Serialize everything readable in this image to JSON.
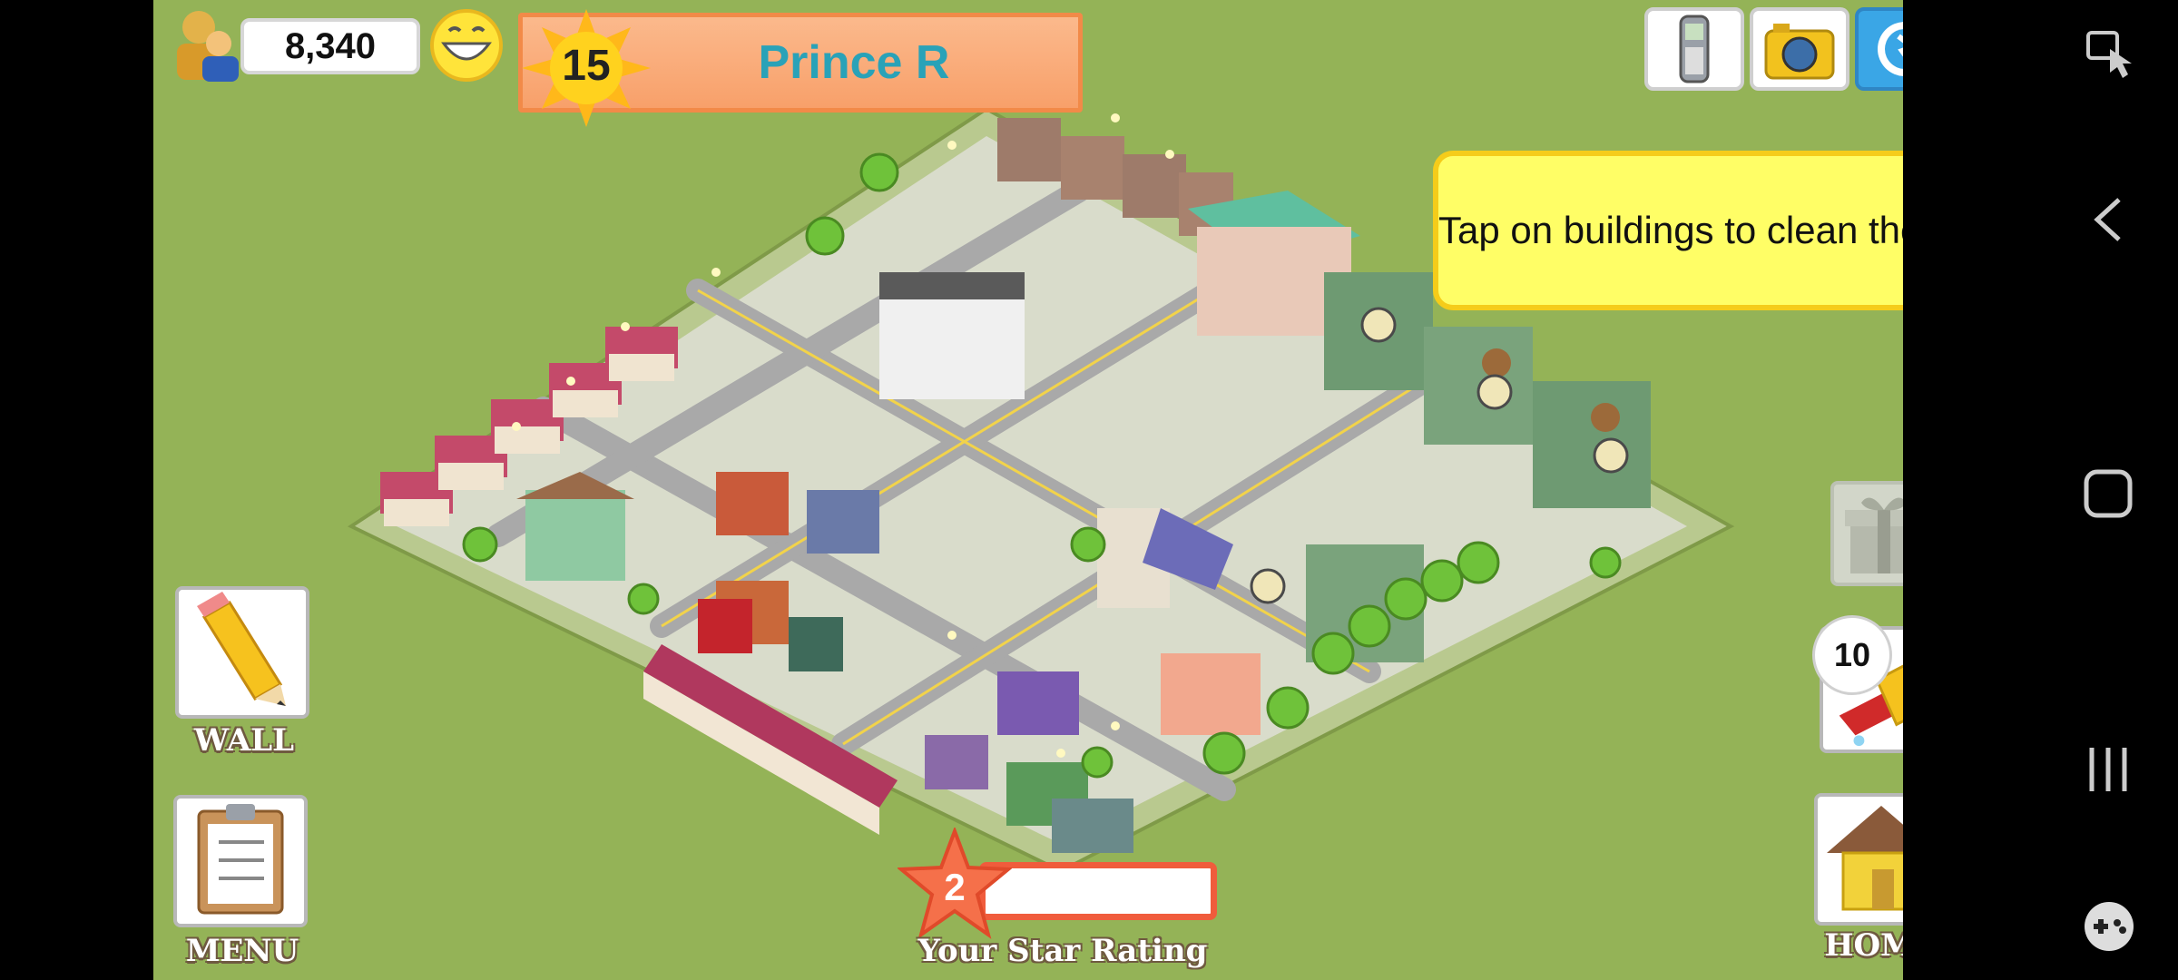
{
  "hud": {
    "population": "8,340",
    "level": "15",
    "player_name": "Prince R"
  },
  "tooltip": "Tap on buildings to clean them.",
  "buttons": {
    "wall": "WALL",
    "menu": "MENU",
    "home": "HOME",
    "clean_count": "10"
  },
  "star_rating": {
    "value": "2",
    "label": "Your Star Rating",
    "progress": 0.0
  },
  "icons": {
    "population": "people-icon",
    "happiness": "smiley-icon",
    "level": "sun-badge-icon",
    "phone": "cellphone-icon",
    "camera": "camera-icon",
    "social": "game-network-icon",
    "gift": "gift-icon",
    "clean": "sponge-icon",
    "wall": "pencil-icon",
    "menu": "clipboard-icon",
    "home": "house-icon"
  },
  "colors": {
    "grass": "#94b357",
    "banner": "#f8a06a",
    "player_name": "#29a2b8",
    "tooltip_bg": "#fffe66",
    "star": "#f05c3c"
  }
}
